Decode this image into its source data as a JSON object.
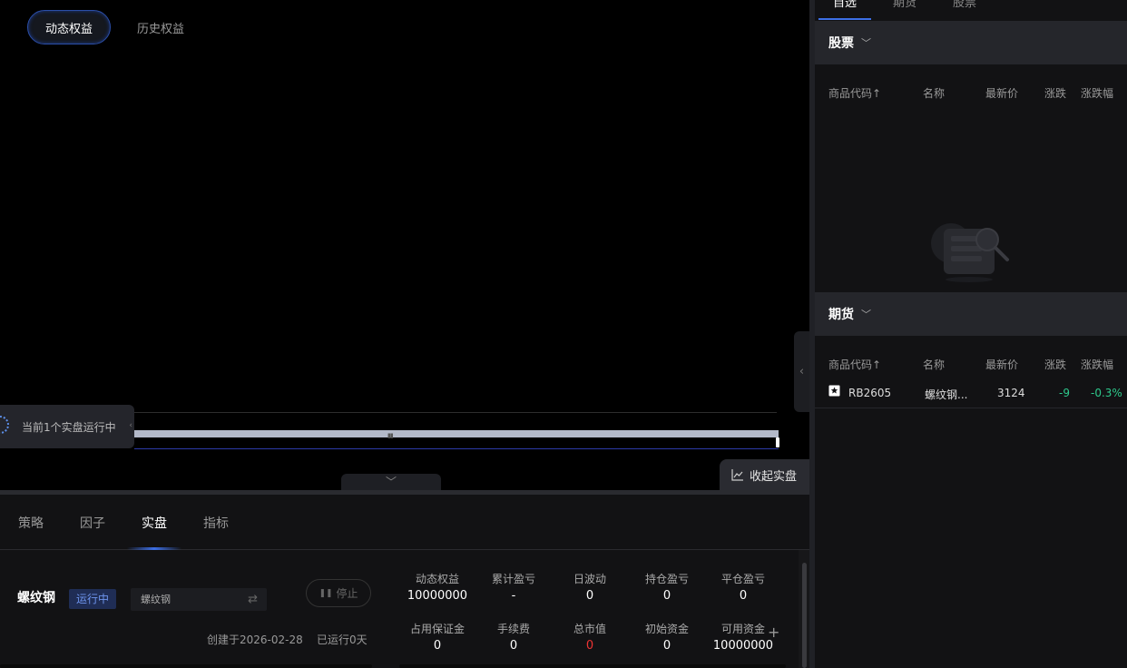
{
  "equity_tabs": [
    "动态权益",
    "历史权益"
  ],
  "running_badge": "当前1个实盘运行中",
  "collapse_live_label": "收起实盘",
  "bottom_tabs": [
    "策略",
    "因子",
    "实盘",
    "指标"
  ],
  "strategy": {
    "name": "螺纹钢",
    "status": "运行中",
    "symbol": "螺纹钢",
    "stop_label": "停止",
    "created": "创建于2026-02-28",
    "runtime": "已运行0天"
  },
  "stats": [
    {
      "label": "动态权益",
      "value": "10000000"
    },
    {
      "label": "累计盈亏",
      "value": "-"
    },
    {
      "label": "日波动",
      "value": "0"
    },
    {
      "label": "持仓盈亏",
      "value": "0"
    },
    {
      "label": "平仓盈亏",
      "value": "0"
    },
    {
      "label": "占用保证金",
      "value": "0"
    },
    {
      "label": "手续费",
      "value": "0"
    },
    {
      "label": "总市值",
      "value": "0"
    },
    {
      "label": "初始资金",
      "value": "0"
    },
    {
      "label": "可用资金",
      "value": "10000000"
    }
  ],
  "watchlist": {
    "tabs": [
      "自选",
      "期货",
      "股票"
    ],
    "stocks_title": "股票",
    "futures_title": "期货",
    "columns": [
      "商品代码↑",
      "名称",
      "最新价",
      "涨跌",
      "涨跌幅"
    ],
    "futures_rows": [
      {
        "code": "RB2605",
        "name": "螺纹钢...",
        "price": "3124",
        "change": "-9",
        "pct": "-0.3%"
      }
    ]
  },
  "colors": {
    "accent": "#3d6fe6",
    "up": "#2ec98c",
    "down": "#e33333"
  }
}
